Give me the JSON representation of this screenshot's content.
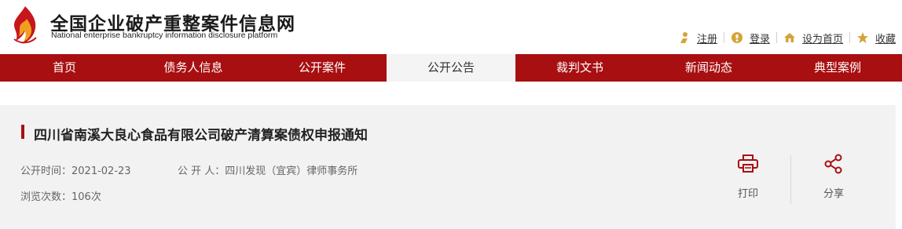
{
  "site": {
    "title": "全国企业破产重整案件信息网",
    "subtitle": "National enterprise bankruptcy  information disclosure platform"
  },
  "toplinks": [
    {
      "label": "注册",
      "icon": "user-icon"
    },
    {
      "label": "登录",
      "icon": "login-icon"
    },
    {
      "label": "设为首页",
      "icon": "home-icon"
    },
    {
      "label": "收藏",
      "icon": "star-icon"
    }
  ],
  "nav": [
    {
      "label": "首页",
      "active": false
    },
    {
      "label": "债务人信息",
      "active": false
    },
    {
      "label": "公开案件",
      "active": false
    },
    {
      "label": "公开公告",
      "active": true
    },
    {
      "label": "裁判文书",
      "active": false
    },
    {
      "label": "新闻动态",
      "active": false
    },
    {
      "label": "典型案例",
      "active": false
    }
  ],
  "notice": {
    "title": "四川省南溪大良心食品有限公司破产清算案债权申报通知",
    "date": "公开时间：2021-02-23",
    "publisher": "公 开 人：四川发现（宜宾）律师事务所",
    "views": "浏览次数：106次"
  },
  "actions": {
    "print_label": "打印",
    "share_label": "分享"
  },
  "colors": {
    "brand_red": "#a80f10",
    "icon_gold": "#d4a43a",
    "content_bg": "#f2f2f2"
  }
}
